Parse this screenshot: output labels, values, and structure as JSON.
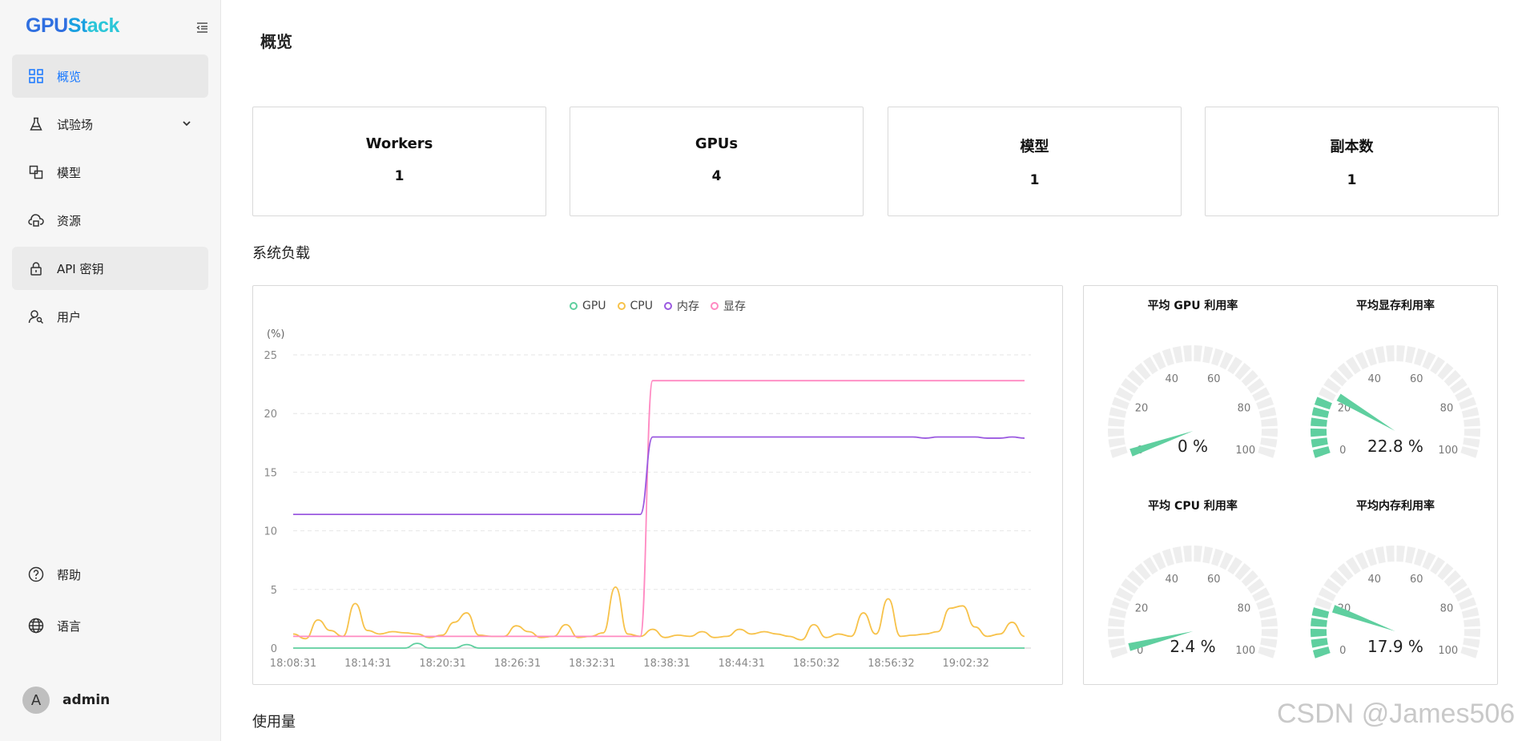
{
  "sidebar": {
    "logo": {
      "part1": "GPU",
      "part2": "St",
      "part3": "ack"
    },
    "items": [
      {
        "label": "概览",
        "icon": "grid-icon",
        "active": true
      },
      {
        "label": "试验场",
        "icon": "flask-icon",
        "has_submenu": true
      },
      {
        "label": "模型",
        "icon": "model-icon"
      },
      {
        "label": "资源",
        "icon": "cloud-icon"
      },
      {
        "label": "API 密钥",
        "icon": "lock-icon"
      },
      {
        "label": "用户",
        "icon": "user-icon"
      }
    ],
    "bottom_items": [
      {
        "label": "帮助",
        "icon": "help-icon"
      },
      {
        "label": "语言",
        "icon": "globe-icon"
      }
    ],
    "user": {
      "avatar_letter": "A",
      "name": "admin"
    }
  },
  "main": {
    "title": "概览",
    "stats": [
      {
        "label": "Workers",
        "value": "1"
      },
      {
        "label": "GPUs",
        "value": "4"
      },
      {
        "label": "模型",
        "value": "1"
      },
      {
        "label": "副本数",
        "value": "1"
      }
    ],
    "system_load_title": "系统负载",
    "usage_title": "使用量"
  },
  "gauges": [
    {
      "title": "平均 GPU 利用率",
      "value": 0,
      "display": "0 %"
    },
    {
      "title": "平均显存利用率",
      "value": 22.8,
      "display": "22.8 %"
    },
    {
      "title": "平均 CPU 利用率",
      "value": 2.4,
      "display": "2.4 %"
    },
    {
      "title": "平均内存利用率",
      "value": 17.9,
      "display": "17.9 %"
    }
  ],
  "gauge_ticks": [
    "0",
    "20",
    "40",
    "60",
    "80",
    "100"
  ],
  "colors": {
    "accent": "#1677ff",
    "gauge": "#5fcf9f",
    "gpu": "#5fcf9f",
    "cpu": "#f7c24a",
    "mem": "#9b59e0",
    "vram": "#ff8ac2"
  },
  "watermark": "CSDN @James506",
  "chart_data": {
    "type": "line",
    "ylabel": "(%)",
    "ylim": [
      0,
      25
    ],
    "yticks": [
      "0",
      "5",
      "10",
      "15",
      "20",
      "25"
    ],
    "xtick_labels": [
      "18:08:31",
      "18:14:31",
      "18:20:31",
      "18:26:31",
      "18:32:31",
      "18:38:31",
      "18:44:31",
      "18:50:32",
      "18:56:32",
      "19:02:32"
    ],
    "legend": [
      "GPU",
      "CPU",
      "内存",
      "显存"
    ],
    "series": [
      {
        "name": "GPU",
        "color": "#5fcf9f",
        "values": [
          0,
          0,
          0,
          0,
          0,
          0,
          0,
          0,
          0,
          0,
          0.4,
          0,
          0,
          0,
          0.3,
          0,
          0,
          0,
          0,
          0,
          0,
          0,
          0,
          0,
          0,
          0,
          0,
          0,
          0,
          0,
          0,
          0,
          0,
          0,
          0,
          0,
          0,
          0,
          0,
          0,
          0,
          0,
          0,
          0,
          0,
          0,
          0,
          0,
          0,
          0,
          0,
          0,
          0,
          0,
          0,
          0,
          0,
          0,
          0,
          0
        ]
      },
      {
        "name": "CPU",
        "color": "#f7c24a",
        "values": [
          1.2,
          0.8,
          2.4,
          1.5,
          1.0,
          3.8,
          1.5,
          1.2,
          1.4,
          1.3,
          1.2,
          0.9,
          1.1,
          2.2,
          3.0,
          1.1,
          1.0,
          1.0,
          1.9,
          1.4,
          0.9,
          1.0,
          2.0,
          0.9,
          1.0,
          1.3,
          5.2,
          1.2,
          1.0,
          1.6,
          0.9,
          1.1,
          1.0,
          1.4,
          0.9,
          1.0,
          1.6,
          1.2,
          1.4,
          1.2,
          1.0,
          0.7,
          2.0,
          0.9,
          1.2,
          1.0,
          3.0,
          1.2,
          4.2,
          1.0,
          1.1,
          1.2,
          1.4,
          3.4,
          3.6,
          1.8,
          1.0,
          1.2,
          2.2,
          1.0
        ]
      },
      {
        "name": "内存",
        "color": "#9b59e0",
        "values": [
          11.4,
          11.4,
          11.4,
          11.4,
          11.4,
          11.4,
          11.4,
          11.4,
          11.4,
          11.4,
          11.4,
          11.4,
          11.4,
          11.4,
          11.4,
          11.4,
          11.4,
          11.4,
          11.4,
          11.4,
          11.4,
          11.4,
          11.4,
          11.4,
          11.4,
          11.4,
          11.4,
          11.4,
          11.4,
          18.0,
          18.0,
          18.0,
          18.0,
          18.0,
          18.0,
          18.0,
          18.0,
          18.0,
          18.0,
          18.0,
          18.0,
          18.0,
          18.0,
          18.0,
          18.0,
          18.0,
          18.0,
          18.0,
          18.0,
          18.0,
          18.0,
          17.9,
          18.0,
          18.0,
          18.0,
          18.0,
          17.9,
          17.9,
          18.0,
          17.9
        ]
      },
      {
        "name": "显存",
        "color": "#ff8ac2",
        "values": [
          1.0,
          1.0,
          1.0,
          1.0,
          1.0,
          1.0,
          1.0,
          1.0,
          1.0,
          1.0,
          1.0,
          1.0,
          1.0,
          1.0,
          1.0,
          1.0,
          1.0,
          1.0,
          1.0,
          1.0,
          1.0,
          1.0,
          1.0,
          1.0,
          1.0,
          1.0,
          1.0,
          1.0,
          1.0,
          22.8,
          22.8,
          22.8,
          22.8,
          22.8,
          22.8,
          22.8,
          22.8,
          22.8,
          22.8,
          22.8,
          22.8,
          22.8,
          22.8,
          22.8,
          22.8,
          22.8,
          22.8,
          22.8,
          22.8,
          22.8,
          22.8,
          22.8,
          22.8,
          22.8,
          22.8,
          22.8,
          22.8,
          22.8,
          22.8,
          22.8
        ]
      }
    ]
  }
}
